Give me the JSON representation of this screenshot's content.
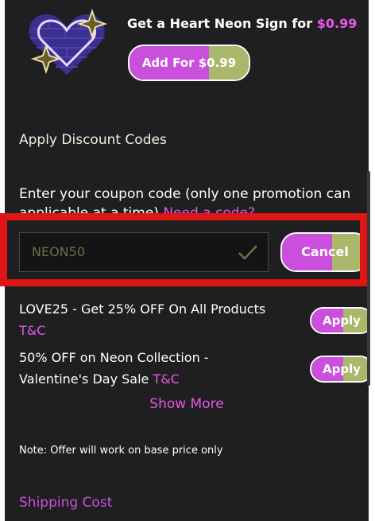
{
  "upsell": {
    "text": "Get a Heart Neon Sign for ",
    "price": "$0.99",
    "button_label": "Add For $0.99"
  },
  "discount": {
    "title": "Apply Discount Codes",
    "description": "Enter your coupon code (only one promotion can applicable at a time)",
    "need_code_link": "Need a code?",
    "input_value": "NEON50",
    "cancel_label": "Cancel"
  },
  "offers": [
    {
      "text": "LOVE25 - Get 25% OFF On All Products",
      "tc": "T&C",
      "apply_label": "Apply"
    },
    {
      "line1": "50% OFF on Neon Collection -",
      "line2": "Valentine's Day Sale",
      "tc": "T&C",
      "apply_label": "Apply"
    }
  ],
  "show_more": "Show More",
  "note": "Note: Offer will work on base price only",
  "shipping_title": "Shipping Cost",
  "colors": {
    "background": "#1f1f21",
    "accent_purple": "#c94fdc",
    "accent_green": "#a9b86a",
    "highlight_red": "#e01515",
    "link_pink": "#e657e6"
  }
}
